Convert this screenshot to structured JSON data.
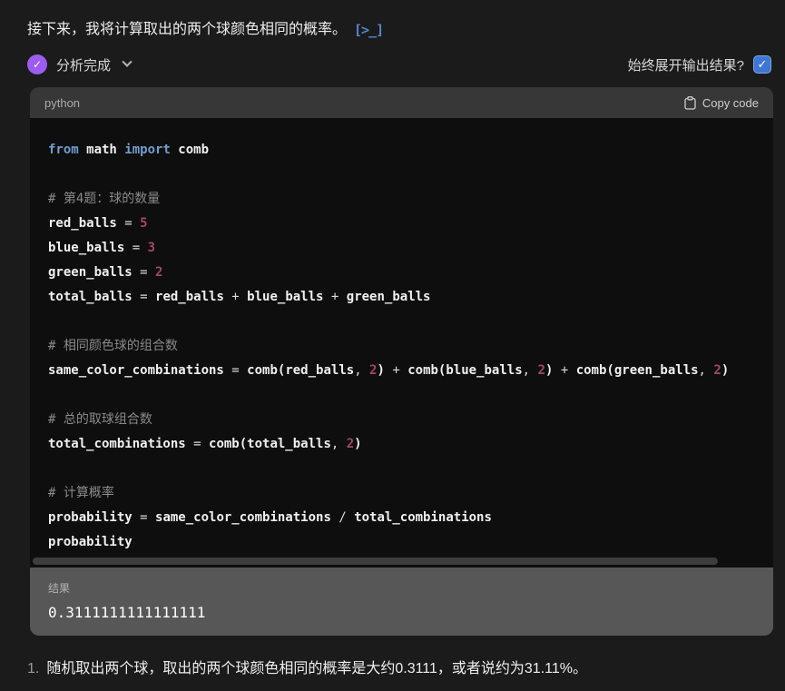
{
  "message": {
    "text": "接下来，我将计算取出的两个球颜色相同的概率。",
    "tool_icon_glyph": "[>_]"
  },
  "analysis": {
    "status_label": "分析完成",
    "toggle_label": "始终展开输出结果?",
    "checkbox_checked": true,
    "check_glyph": "✓"
  },
  "code_block": {
    "language": "python",
    "copy_label": "Copy code",
    "lines": [
      [
        {
          "t": "kw",
          "s": "from"
        },
        {
          "t": "name",
          "s": " math "
        },
        {
          "t": "kw",
          "s": "import"
        },
        {
          "t": "name",
          "s": " comb"
        }
      ],
      [],
      [
        {
          "t": "comment",
          "s": "# 第4题：球的数量"
        }
      ],
      [
        {
          "t": "name",
          "s": "red_balls"
        },
        {
          "t": "op",
          "s": " = "
        },
        {
          "t": "num",
          "s": "5"
        }
      ],
      [
        {
          "t": "name",
          "s": "blue_balls"
        },
        {
          "t": "op",
          "s": " = "
        },
        {
          "t": "num",
          "s": "3"
        }
      ],
      [
        {
          "t": "name",
          "s": "green_balls"
        },
        {
          "t": "op",
          "s": " = "
        },
        {
          "t": "num",
          "s": "2"
        }
      ],
      [
        {
          "t": "name",
          "s": "total_balls"
        },
        {
          "t": "op",
          "s": " = "
        },
        {
          "t": "name",
          "s": "red_balls"
        },
        {
          "t": "op",
          "s": " + "
        },
        {
          "t": "name",
          "s": "blue_balls"
        },
        {
          "t": "op",
          "s": " + "
        },
        {
          "t": "name",
          "s": "green_balls"
        }
      ],
      [],
      [
        {
          "t": "comment",
          "s": "# 相同颜色球的组合数"
        }
      ],
      [
        {
          "t": "name",
          "s": "same_color_combinations"
        },
        {
          "t": "op",
          "s": " = "
        },
        {
          "t": "name",
          "s": "comb(red_balls"
        },
        {
          "t": "op",
          "s": ", "
        },
        {
          "t": "num",
          "s": "2"
        },
        {
          "t": "name",
          "s": ")"
        },
        {
          "t": "op",
          "s": " + "
        },
        {
          "t": "name",
          "s": "comb(blue_balls"
        },
        {
          "t": "op",
          "s": ", "
        },
        {
          "t": "num",
          "s": "2"
        },
        {
          "t": "name",
          "s": ")"
        },
        {
          "t": "op",
          "s": " + "
        },
        {
          "t": "name",
          "s": "comb(green_balls"
        },
        {
          "t": "op",
          "s": ", "
        },
        {
          "t": "num",
          "s": "2"
        },
        {
          "t": "name",
          "s": ")"
        }
      ],
      [],
      [
        {
          "t": "comment",
          "s": "# 总的取球组合数"
        }
      ],
      [
        {
          "t": "name",
          "s": "total_combinations"
        },
        {
          "t": "op",
          "s": " = "
        },
        {
          "t": "name",
          "s": "comb(total_balls"
        },
        {
          "t": "op",
          "s": ", "
        },
        {
          "t": "num",
          "s": "2"
        },
        {
          "t": "name",
          "s": ")"
        }
      ],
      [],
      [
        {
          "t": "comment",
          "s": "# 计算概率"
        }
      ],
      [
        {
          "t": "name",
          "s": "probability"
        },
        {
          "t": "op",
          "s": " = "
        },
        {
          "t": "name",
          "s": "same_color_combinations"
        },
        {
          "t": "op",
          "s": " / "
        },
        {
          "t": "name",
          "s": "total_combinations"
        }
      ],
      [
        {
          "t": "name",
          "s": "probability"
        }
      ]
    ]
  },
  "result": {
    "label": "结果",
    "value": "0.3111111111111111"
  },
  "conclusion": {
    "number": "1.",
    "text": "随机取出两个球，取出的两个球颜色相同的概率是大约0.3111，或者说约为31.11%。"
  },
  "colors": {
    "bg": "#1b1b1b",
    "card_header_bg": "#373737",
    "code_bg": "#0e0e0e",
    "result_bg": "#575757",
    "accent_purple": "#9d5cf0",
    "accent_blue": "#3e76d6",
    "kw_blue": "#6f9fce",
    "num_pink": "#a34667",
    "comment_gray": "#8a8a8a",
    "code_white": "#f0f0f0",
    "ui_text": "#e6e6e6"
  }
}
